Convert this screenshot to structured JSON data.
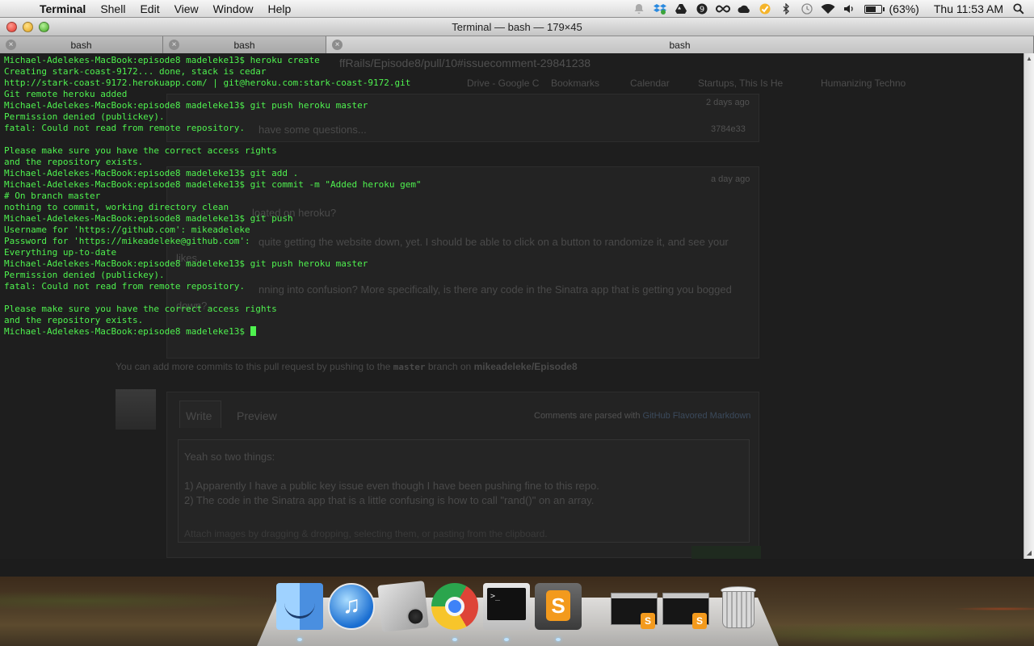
{
  "menubar": {
    "apple_symbol": "",
    "app_name": "Terminal",
    "menus": [
      "Shell",
      "Edit",
      "View",
      "Window",
      "Help"
    ],
    "status_icons": [
      "notification-icon",
      "dropbox-icon",
      "google-drive-icon",
      "evernote-icon",
      "infinity-icon",
      "cloud-icon",
      "checkmark-icon",
      "bluetooth-icon",
      "time-machine-icon",
      "wifi-icon",
      "volume-icon"
    ],
    "battery_level": 0.63,
    "battery_text": "(63%)",
    "clock": "Thu 11:53 AM"
  },
  "window": {
    "title": "Terminal — bash — 179×45",
    "tabs": [
      {
        "label": "bash"
      },
      {
        "label": "bash"
      },
      {
        "label": "bash"
      }
    ]
  },
  "terminal": {
    "lines": [
      "Michael-Adelekes-MacBook:episode8 madeleke13$ heroku create",
      "Creating stark-coast-9172... done, stack is cedar",
      "http://stark-coast-9172.herokuapp.com/ | git@heroku.com:stark-coast-9172.git",
      "Git remote heroku added",
      "Michael-Adelekes-MacBook:episode8 madeleke13$ git push heroku master",
      "Permission denied (publickey).",
      "fatal: Could not read from remote repository.",
      "",
      "Please make sure you have the correct access rights",
      "and the repository exists.",
      "Michael-Adelekes-MacBook:episode8 madeleke13$ git add .",
      "Michael-Adelekes-MacBook:episode8 madeleke13$ git commit -m \"Added heroku gem\"",
      "# On branch master",
      "nothing to commit, working directory clean",
      "Michael-Adelekes-MacBook:episode8 madeleke13$ git push",
      "Username for 'https://github.com': mikeadeleke",
      "Password for 'https://mikeadeleke@github.com':",
      "Everything up-to-date",
      "Michael-Adelekes-MacBook:episode8 madeleke13$ git push heroku master",
      "Permission denied (publickey).",
      "fatal: Could not read from remote repository.",
      "",
      "Please make sure you have the correct access rights",
      "and the repository exists.",
      "Michael-Adelekes-MacBook:episode8 madeleke13$ "
    ],
    "text_color": "#4ff24f"
  },
  "ghost_page": {
    "url_fragment": "ffRails/Episode8/pull/10#issuecomment-29841238",
    "bookmarks": [
      "Drive - Google C",
      "Bookmarks",
      "Calendar",
      "Startups, This Is He",
      "Humanizing Techno"
    ],
    "timestamp_1": "2 days ago",
    "commit_msg": "have some questions...",
    "commit_sha": "3784e33",
    "timestamp_2": "a day ago",
    "comment_line_1": "loated on heroku?",
    "comment_line_2": "quite getting the website down, yet. I should be able to click on a button to randomize it, and see your",
    "comment_line_3": "likes.",
    "comment_line_4": "nning into confusion? More specifically, is there any code in the Sinatra app that is getting you bogged",
    "comment_line_5": "down?",
    "pr_note_pre": "You can add more commits to this pull request by pushing to the",
    "pr_note_branch": "master",
    "pr_note_mid": "branch on",
    "pr_note_repo": "mikeadeleke/Episode8",
    "tab_write": "Write",
    "tab_preview": "Preview",
    "markdown_note": "Comments are parsed with",
    "markdown_link": "GitHub Flavored Markdown",
    "draft_1": "Yeah so two things:",
    "draft_2": "1) Apparently I have a public key issue even though I have been pushing fine to this repo.",
    "draft_3": "2) The code in the Sinatra app that is a little confusing is how to call \"rand()\" on an array.",
    "attach_note": "Attach images by dragging & dropping, selecting them, or pasting from the clipboard."
  },
  "dock": {
    "items": [
      "finder-icon",
      "itunes-icon",
      "iphoto-icon",
      "chrome-icon",
      "terminal-icon",
      "sublime-text-icon",
      "minimized-window-1",
      "minimized-window-2",
      "trash-icon"
    ],
    "terminal_icon_prompt": ">_",
    "sublime_letter": "S"
  }
}
